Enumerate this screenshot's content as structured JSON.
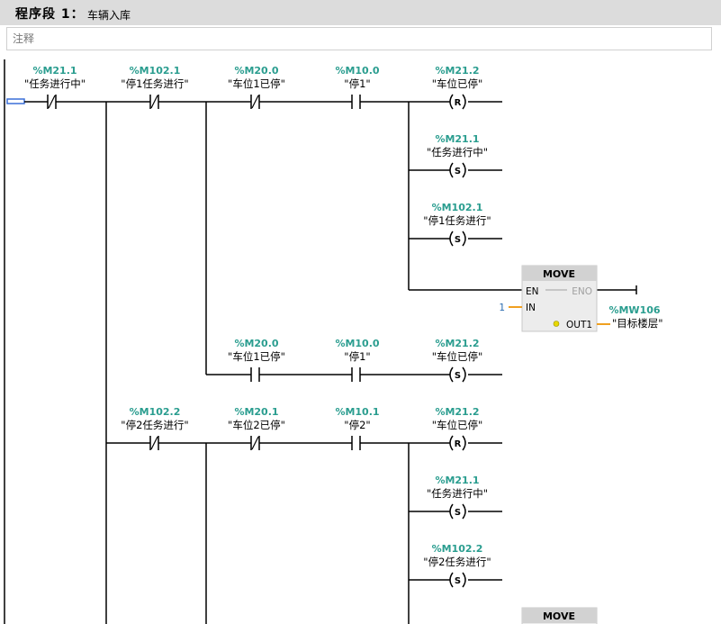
{
  "segment": {
    "title": "程序段 1：",
    "name": "车辆入库"
  },
  "comment": {
    "placeholder": "注释"
  },
  "rung1": {
    "contacts": [
      {
        "addr": "%M21.1",
        "tag": "\"任务进行中\""
      },
      {
        "addr": "%M102.1",
        "tag": "\"停1任务进行\""
      },
      {
        "addr": "%M20.0",
        "tag": "\"车位1已停\""
      },
      {
        "addr": "%M10.0",
        "tag": "\"停1\""
      }
    ],
    "coils": [
      {
        "addr": "%M21.2",
        "tag": "\"车位已停\"",
        "type": "R"
      },
      {
        "addr": "%M21.1",
        "tag": "\"任务进行中\"",
        "type": "S"
      },
      {
        "addr": "%M102.1",
        "tag": "\"停1任务进行\"",
        "type": "S"
      }
    ],
    "move": {
      "title": "MOVE",
      "en": "EN",
      "eno": "ENO",
      "in_label": "IN",
      "in_value": "1",
      "out_label": "OUT1",
      "out_addr": "%MW106",
      "out_tag": "\"目标楼层\""
    }
  },
  "branch1": {
    "contacts": [
      {
        "addr": "%M20.0",
        "tag": "\"车位1已停\""
      },
      {
        "addr": "%M10.0",
        "tag": "\"停1\""
      }
    ],
    "coil": {
      "addr": "%M21.2",
      "tag": "\"车位已停\"",
      "type": "S"
    }
  },
  "rung2": {
    "contacts": [
      {
        "addr": "%M102.2",
        "tag": "\"停2任务进行\""
      },
      {
        "addr": "%M20.1",
        "tag": "\"车位2已停\""
      },
      {
        "addr": "%M10.1",
        "tag": "\"停2\""
      }
    ],
    "coils": [
      {
        "addr": "%M21.2",
        "tag": "\"车位已停\"",
        "type": "R"
      },
      {
        "addr": "%M21.1",
        "tag": "\"任务进行中\"",
        "type": "S"
      },
      {
        "addr": "%M102.2",
        "tag": "\"停2任务进行\"",
        "type": "S"
      }
    ],
    "move": {
      "title": "MOVE"
    }
  },
  "colors": {
    "wire": "#000000",
    "address": "#2a9d8f",
    "header": "#dcdcdc",
    "box": "#ececec",
    "in_line": "#f0a020",
    "selection": "#3a6fd8"
  }
}
